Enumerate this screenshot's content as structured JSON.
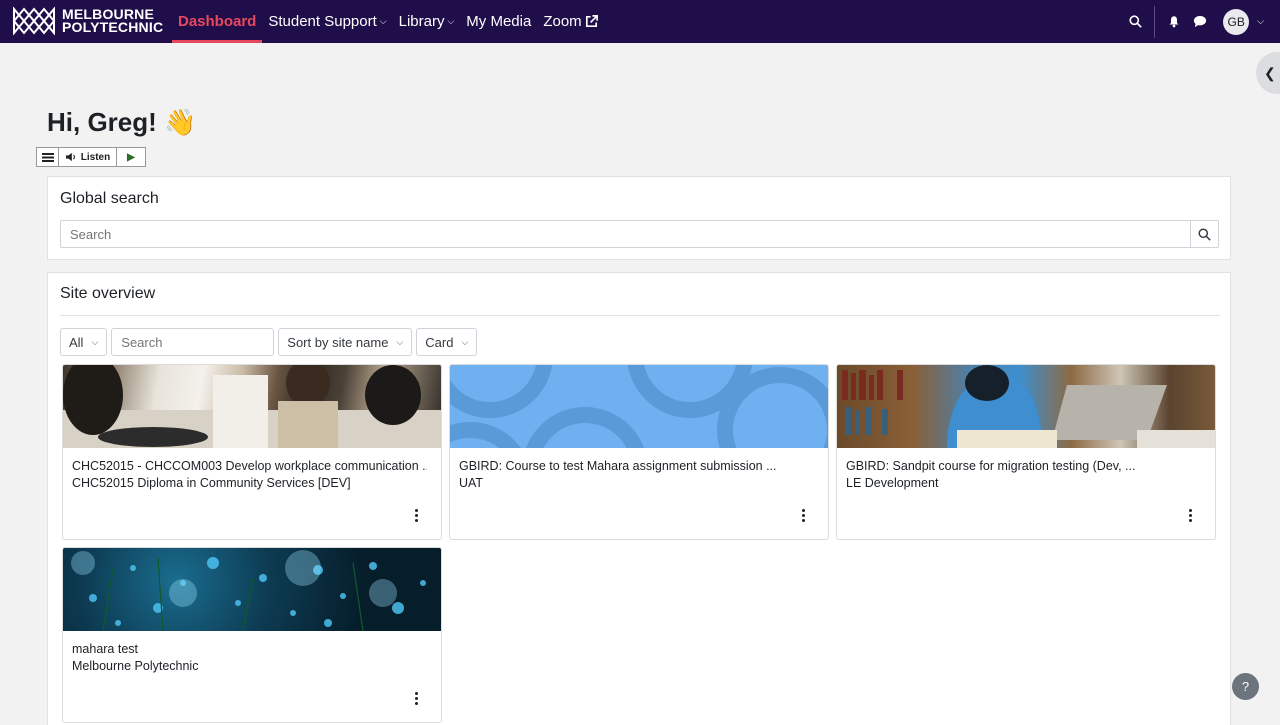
{
  "nav": {
    "logo_line1": "MELBOURNE",
    "logo_line2": "POLYTECHNIC",
    "items": [
      {
        "label": "Dashboard",
        "active": true
      },
      {
        "label": "Student Support",
        "dropdown": true
      },
      {
        "label": "Library",
        "dropdown": true
      },
      {
        "label": "My Media"
      },
      {
        "label": "Zoom",
        "external": true
      }
    ],
    "avatar_initials": "GB",
    "accent_color": "#e8485f",
    "bar_color": "#1f0e4a"
  },
  "greeting": "Hi, Greg! 👋",
  "listen": {
    "label": "Listen"
  },
  "global_search": {
    "title": "Global search",
    "placeholder": "Search"
  },
  "site_overview": {
    "title": "Site overview",
    "filter_all": "All",
    "search_placeholder": "Search",
    "sort_label": "Sort by site name",
    "view_label": "Card",
    "courses": [
      {
        "title": "CHC52015 - CHCCOM003 Develop workplace communication ...",
        "category": "CHC52015 Diploma in Community Services [DEV]",
        "image": "people-working"
      },
      {
        "title": "GBIRD: Course to test Mahara assignment submission ...",
        "category": "UAT",
        "image": "blue-pattern"
      },
      {
        "title": "GBIRD: Sandpit course for migration testing (Dev, ...",
        "category": "LE Development",
        "image": "library-student"
      },
      {
        "title": "mahara test",
        "category": "Melbourne Polytechnic",
        "image": "bokeh-lights"
      }
    ]
  },
  "help_label": "?"
}
